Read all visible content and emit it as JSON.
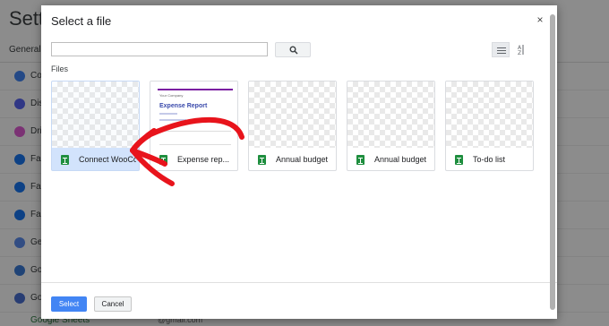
{
  "background": {
    "page_title": "Setti",
    "tab_general": "General",
    "rows": [
      {
        "label": "Co",
        "color": "#4285f4"
      },
      {
        "label": "Dis",
        "color": "#5865f2"
      },
      {
        "label": "Dri",
        "color": "#e05bd4"
      },
      {
        "label": "Fac",
        "color": "#1877f2"
      },
      {
        "label": "Fac",
        "color": "#1877f2"
      },
      {
        "label": "Fac",
        "color": "#1877f2"
      },
      {
        "label": "Ge",
        "color": "#5b8def"
      },
      {
        "label": "Go",
        "color": "#3a7ad8"
      },
      {
        "label": "Go",
        "color": "#4a6fd1"
      }
    ],
    "bottom_label": "Google Sheets",
    "bottom_email": "@gmail.com"
  },
  "dialog": {
    "title": "Select a file",
    "close_symbol": "×",
    "search_value": "",
    "files_label": "Files",
    "select_label": "Select",
    "cancel_label": "Cancel",
    "files": [
      {
        "name": "Connect WooCo...",
        "type": "sheet",
        "selected": true
      },
      {
        "name": "Expense rep...",
        "type": "sheet-preview",
        "selected": false,
        "preview_company": "Your Company",
        "preview_title": "Expense Report"
      },
      {
        "name": "Annual budget",
        "type": "sheet",
        "selected": false
      },
      {
        "name": "Annual budget",
        "type": "sheet",
        "selected": false
      },
      {
        "name": "To-do list",
        "type": "sheet",
        "selected": false
      }
    ]
  },
  "colors": {
    "annotation_arrow": "#e8141c",
    "select_button": "#4285f4",
    "sheet_icon": "#1e8e3e"
  },
  "icons": {
    "search": "search-icon",
    "list_view": "list-view-icon",
    "sort": "sort-icon",
    "close": "close-icon"
  }
}
